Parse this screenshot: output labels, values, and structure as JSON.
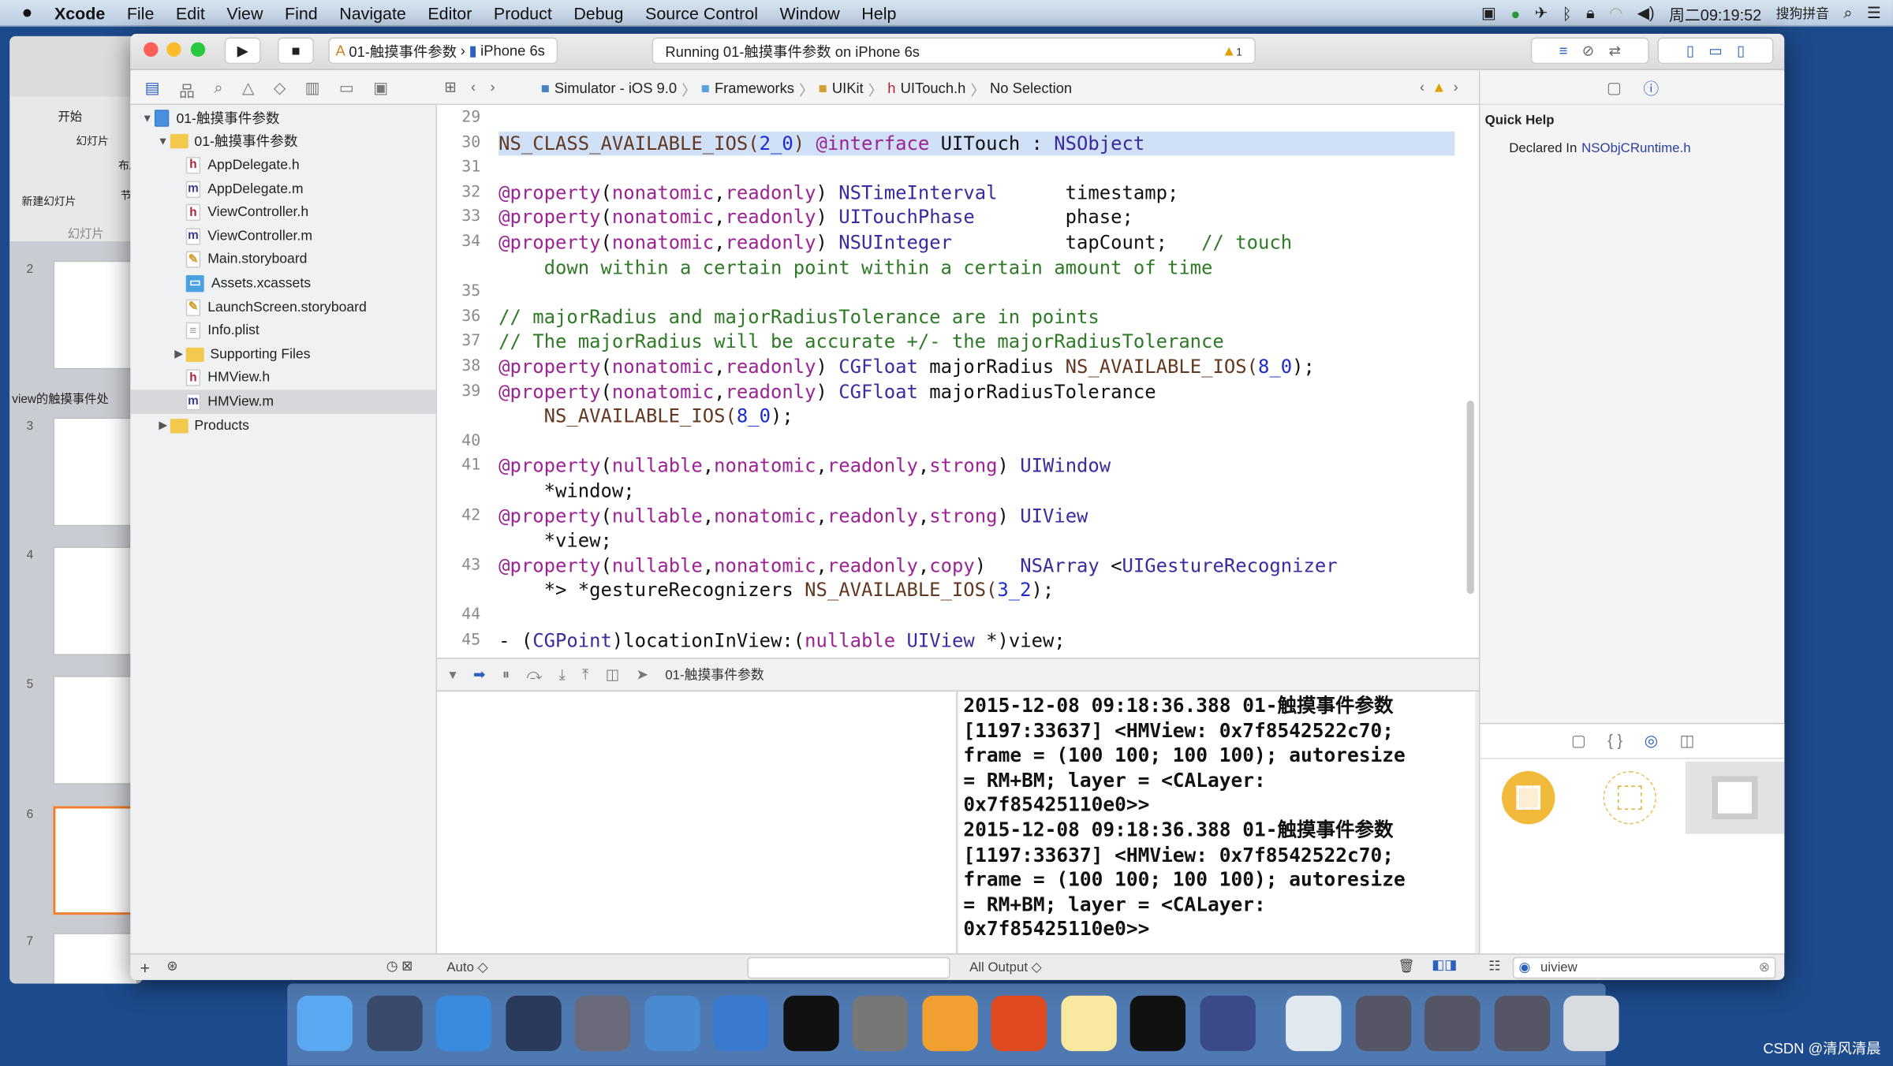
{
  "menubar": {
    "app": "Xcode",
    "items": [
      "File",
      "Edit",
      "View",
      "Find",
      "Navigate",
      "Editor",
      "Product",
      "Debug",
      "Source Control",
      "Window",
      "Help"
    ],
    "clock": "周二09:19:52",
    "input_method": "搜狗拼音"
  },
  "ppt": {
    "tab_home": "开始",
    "group_slides": "幻灯片",
    "new_slide": "新建幻灯片",
    "layout": "布局",
    "section": "节",
    "slides_tab": "幻灯片",
    "section_name": "view的触摸事件处",
    "slide_numbers": [
      "2",
      "3",
      "4",
      "5",
      "6",
      "7"
    ]
  },
  "toolbar": {
    "scheme": "01-触摸事件参数",
    "device": "iPhone 6s",
    "activity": "Running 01-触摸事件参数 on iPhone 6s",
    "warning_count": "1"
  },
  "jumpbar": {
    "items": [
      "Simulator - iOS 9.0",
      "Frameworks",
      "UIKit",
      "UITouch.h",
      "No Selection"
    ]
  },
  "navigator": {
    "items": [
      {
        "label": "01-触摸事件参数",
        "kind": "project",
        "level": 0,
        "open": true
      },
      {
        "label": "01-触摸事件参数",
        "kind": "folder",
        "level": 1,
        "open": true
      },
      {
        "label": "AppDelegate.h",
        "kind": "h",
        "level": 2
      },
      {
        "label": "AppDelegate.m",
        "kind": "m",
        "level": 2
      },
      {
        "label": "ViewController.h",
        "kind": "h",
        "level": 2
      },
      {
        "label": "ViewController.m",
        "kind": "m",
        "level": 2
      },
      {
        "label": "Main.storyboard",
        "kind": "sb",
        "level": 2
      },
      {
        "label": "Assets.xcassets",
        "kind": "assets",
        "level": 2
      },
      {
        "label": "LaunchScreen.storyboard",
        "kind": "sb",
        "level": 2
      },
      {
        "label": "Info.plist",
        "kind": "plist",
        "level": 2
      },
      {
        "label": "Supporting Files",
        "kind": "folder",
        "level": 2,
        "open": false
      },
      {
        "label": "HMView.h",
        "kind": "h",
        "level": 2
      },
      {
        "label": "HMView.m",
        "kind": "m",
        "level": 2,
        "selected": true
      },
      {
        "label": "Products",
        "kind": "folder",
        "level": 1,
        "open": false
      }
    ]
  },
  "code": [
    {
      "n": "29",
      "rows": [
        []
      ]
    },
    {
      "n": "30",
      "hl": true,
      "rows": [
        [
          [
            "NS_CLASS_AVAILABLE_IOS(",
            "mac"
          ],
          [
            "2_0",
            "num"
          ],
          [
            ") ",
            "mac"
          ],
          [
            "@interface",
            "kw"
          ],
          [
            " UITouch : ",
            "pl"
          ],
          [
            "NSObject",
            "type"
          ]
        ]
      ]
    },
    {
      "n": "31",
      "rows": [
        []
      ]
    },
    {
      "n": "32",
      "rows": [
        [
          [
            "@property",
            "kw"
          ],
          [
            "(",
            "pl"
          ],
          [
            "nonatomic",
            "kw"
          ],
          [
            ",",
            "pl"
          ],
          [
            "readonly",
            "kw"
          ],
          [
            ") ",
            "pl"
          ],
          [
            "NSTimeInterval",
            "type"
          ],
          [
            "      timestamp;",
            "pl"
          ]
        ]
      ]
    },
    {
      "n": "33",
      "rows": [
        [
          [
            "@property",
            "kw"
          ],
          [
            "(",
            "pl"
          ],
          [
            "nonatomic",
            "kw"
          ],
          [
            ",",
            "pl"
          ],
          [
            "readonly",
            "kw"
          ],
          [
            ") ",
            "pl"
          ],
          [
            "UITouchPhase",
            "type"
          ],
          [
            "        phase;",
            "pl"
          ]
        ]
      ]
    },
    {
      "n": "34",
      "rows": [
        [
          [
            "@property",
            "kw"
          ],
          [
            "(",
            "pl"
          ],
          [
            "nonatomic",
            "kw"
          ],
          [
            ",",
            "pl"
          ],
          [
            "readonly",
            "kw"
          ],
          [
            ") ",
            "pl"
          ],
          [
            "NSUInteger",
            "type"
          ],
          [
            "          tapCount;   ",
            "pl"
          ],
          [
            "// touch",
            "cm"
          ]
        ],
        [
          [
            "    down within a certain point within a certain amount of time",
            "cm"
          ]
        ]
      ]
    },
    {
      "n": "35",
      "rows": [
        []
      ]
    },
    {
      "n": "36",
      "rows": [
        [
          [
            "// majorRadius and majorRadiusTolerance are in points",
            "cm"
          ]
        ]
      ]
    },
    {
      "n": "37",
      "rows": [
        [
          [
            "// The majorRadius will be accurate +/- the majorRadiusTolerance",
            "cm"
          ]
        ]
      ]
    },
    {
      "n": "38",
      "rows": [
        [
          [
            "@property",
            "kw"
          ],
          [
            "(",
            "pl"
          ],
          [
            "nonatomic",
            "kw"
          ],
          [
            ",",
            "pl"
          ],
          [
            "readonly",
            "kw"
          ],
          [
            ") ",
            "pl"
          ],
          [
            "CGFloat",
            "type"
          ],
          [
            " majorRadius ",
            "pl"
          ],
          [
            "NS_AVAILABLE_IOS(",
            "mac"
          ],
          [
            "8_0",
            "num"
          ],
          [
            ");",
            "pl"
          ]
        ]
      ]
    },
    {
      "n": "39",
      "rows": [
        [
          [
            "@property",
            "kw"
          ],
          [
            "(",
            "pl"
          ],
          [
            "nonatomic",
            "kw"
          ],
          [
            ",",
            "pl"
          ],
          [
            "readonly",
            "kw"
          ],
          [
            ") ",
            "pl"
          ],
          [
            "CGFloat",
            "type"
          ],
          [
            " majorRadiusTolerance",
            "pl"
          ]
        ],
        [
          [
            "    NS_AVAILABLE_IOS(",
            "mac"
          ],
          [
            "8_0",
            "num"
          ],
          [
            ");",
            "pl"
          ]
        ]
      ]
    },
    {
      "n": "40",
      "rows": [
        []
      ]
    },
    {
      "n": "41",
      "rows": [
        [
          [
            "@property",
            "kw"
          ],
          [
            "(",
            "pl"
          ],
          [
            "nullable",
            "kw"
          ],
          [
            ",",
            "pl"
          ],
          [
            "nonatomic",
            "kw"
          ],
          [
            ",",
            "pl"
          ],
          [
            "readonly",
            "kw"
          ],
          [
            ",",
            "pl"
          ],
          [
            "strong",
            "kw"
          ],
          [
            ") ",
            "pl"
          ],
          [
            "UIWindow",
            "type"
          ]
        ],
        [
          [
            "    *window;",
            "pl"
          ]
        ]
      ]
    },
    {
      "n": "42",
      "rows": [
        [
          [
            "@property",
            "kw"
          ],
          [
            "(",
            "pl"
          ],
          [
            "nullable",
            "kw"
          ],
          [
            ",",
            "pl"
          ],
          [
            "nonatomic",
            "kw"
          ],
          [
            ",",
            "pl"
          ],
          [
            "readonly",
            "kw"
          ],
          [
            ",",
            "pl"
          ],
          [
            "strong",
            "kw"
          ],
          [
            ") ",
            "pl"
          ],
          [
            "UIView",
            "type"
          ]
        ],
        [
          [
            "    *view;",
            "pl"
          ]
        ]
      ]
    },
    {
      "n": "43",
      "rows": [
        [
          [
            "@property",
            "kw"
          ],
          [
            "(",
            "pl"
          ],
          [
            "nullable",
            "kw"
          ],
          [
            ",",
            "pl"
          ],
          [
            "nonatomic",
            "kw"
          ],
          [
            ",",
            "pl"
          ],
          [
            "readonly",
            "kw"
          ],
          [
            ",",
            "pl"
          ],
          [
            "copy",
            "kw"
          ],
          [
            ")   ",
            "pl"
          ],
          [
            "NSArray",
            "type"
          ],
          [
            " <",
            "pl"
          ],
          [
            "UIGestureRecognizer",
            "type"
          ]
        ],
        [
          [
            "    *> *gestureRecognizers ",
            "pl"
          ],
          [
            "NS_AVAILABLE_IOS(",
            "mac"
          ],
          [
            "3_2",
            "num"
          ],
          [
            ");",
            "pl"
          ]
        ]
      ]
    },
    {
      "n": "44",
      "rows": [
        []
      ]
    },
    {
      "n": "45",
      "rows": [
        [
          [
            "- (",
            "pl"
          ],
          [
            "CGPoint",
            "type"
          ],
          [
            ")locationInView:(",
            "pl"
          ],
          [
            "nullable",
            "kw"
          ],
          [
            " ",
            "pl"
          ],
          [
            "UIView",
            "type"
          ],
          [
            " *)view;",
            "pl"
          ]
        ]
      ]
    }
  ],
  "debugbar": {
    "target": "01-触摸事件参数"
  },
  "console": {
    "text": "2015-12-08 09:18:36.388 01-触摸事件参数\n[1197:33637] <HMView: 0x7f8542522c70;\nframe = (100 100; 100 100); autoresize\n= RM+BM; layer = <CALayer:\n0x7f85425110e0>>\n2015-12-08 09:18:36.388 01-触摸事件参数\n[1197:33637] <HMView: 0x7f8542522c70;\nframe = (100 100; 100 100); autoresize\n= RM+BM; layer = <CALayer:\n0x7f85425110e0>>"
  },
  "bottombar": {
    "auto": "Auto ◇",
    "output": "All Output ◇",
    "library_search": "uiview"
  },
  "quickhelp": {
    "title": "Quick Help",
    "declared_label": "Declared In",
    "declared_value": "NSObjCRuntime.h"
  },
  "dock": {
    "apps": [
      "finder",
      "launchpad",
      "safari",
      "mouse-app",
      "imovie",
      "xcode",
      "instruments",
      "terminal",
      "system-preferences",
      "sketch",
      "powerpoint",
      "notes",
      "console",
      "quicktime",
      "preview",
      "screen1",
      "screen2",
      "screen3",
      "trash"
    ]
  },
  "watermark": "CSDN @清风清晨",
  "colors": {
    "keyword": "#9b2393",
    "type": "#3b2aa0",
    "comment": "#2e7a26",
    "accent": "#1f6bd6",
    "warning": "#f0b400"
  }
}
